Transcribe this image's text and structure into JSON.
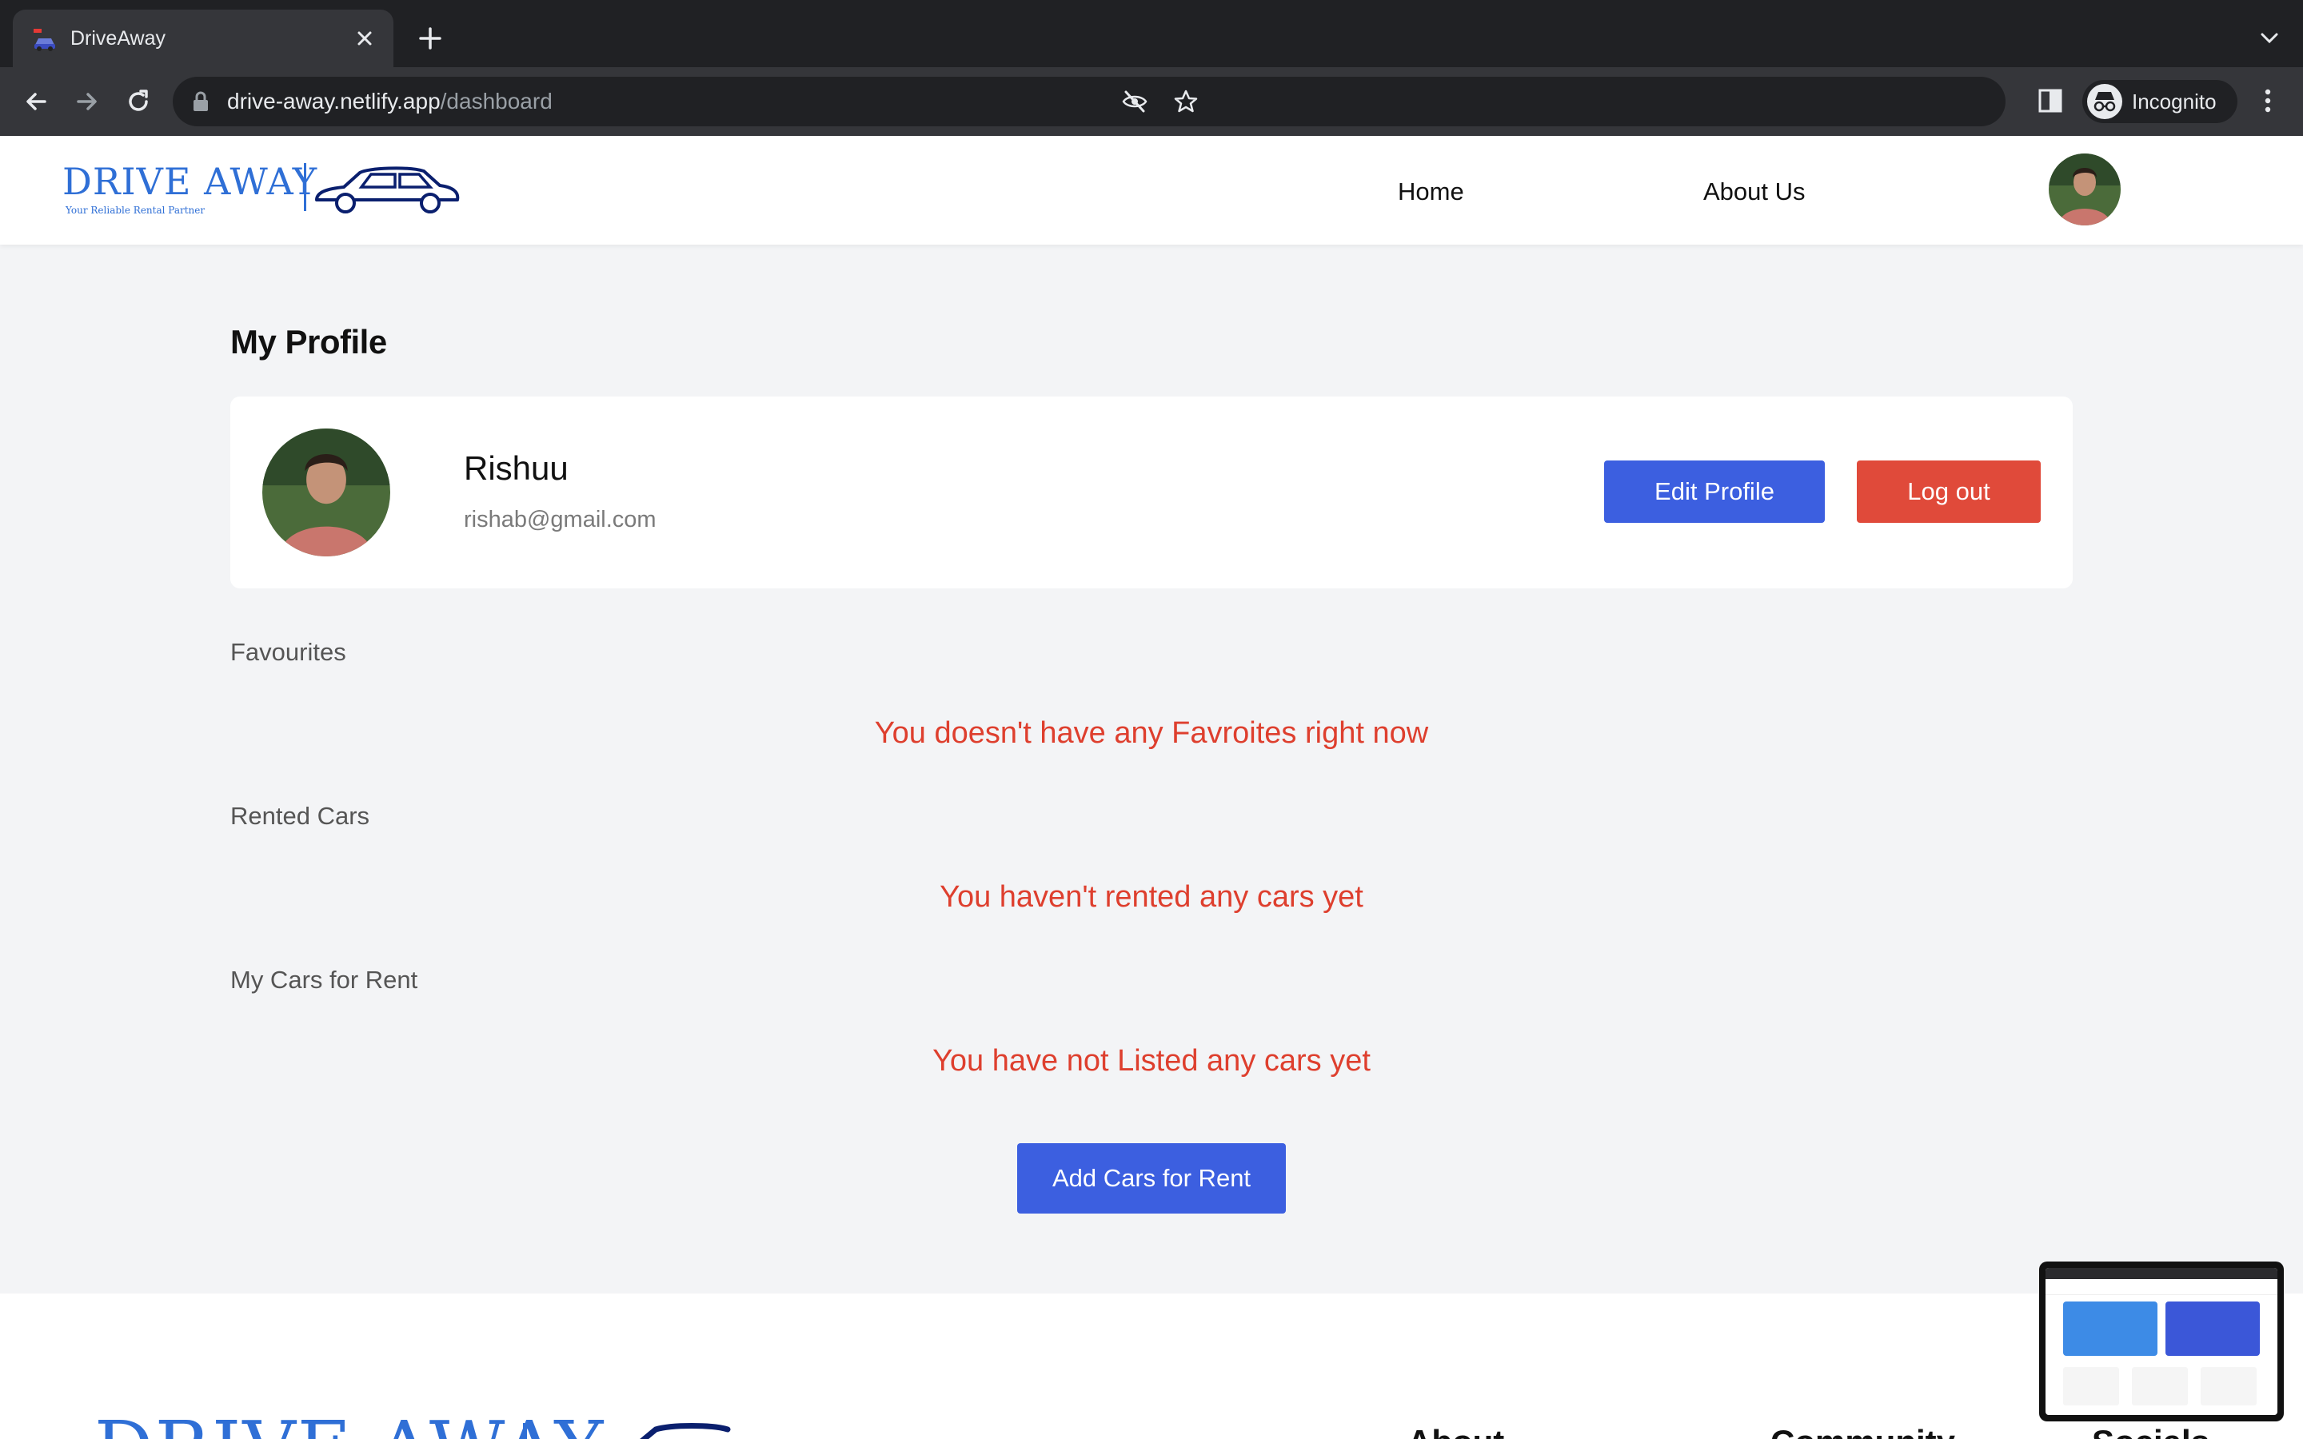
{
  "browser": {
    "tab_title": "DriveAway",
    "url_host": "drive-away.netlify.app",
    "url_path": "/dashboard",
    "incognito_label": "Incognito"
  },
  "header": {
    "logo_text": "DRIVE AWAY",
    "logo_tagline": "Your Reliable Rental Partner",
    "nav": [
      {
        "label": "Home"
      },
      {
        "label": "About Us"
      }
    ]
  },
  "profile": {
    "title": "My Profile",
    "name": "Rishuu",
    "email": "rishab@gmail.com",
    "edit_label": "Edit Profile",
    "logout_label": "Log out"
  },
  "sections": {
    "favourites": {
      "label": "Favourites",
      "empty": "You doesn't have any Favroites right now"
    },
    "rented": {
      "label": "Rented Cars",
      "empty": "You haven't rented any cars yet"
    },
    "my_cars": {
      "label": "My Cars for Rent",
      "empty": "You have not Listed any cars yet"
    },
    "add_label": "Add Cars for Rent"
  },
  "footer": {
    "logo_text": "DRIVE AWAY",
    "headings": [
      "About",
      "Community",
      "Socials"
    ]
  },
  "colors": {
    "primary": "#3c5fe0",
    "danger": "#e04a3a",
    "empty_text": "#de3f2e",
    "brand": "#2f6fd6"
  }
}
